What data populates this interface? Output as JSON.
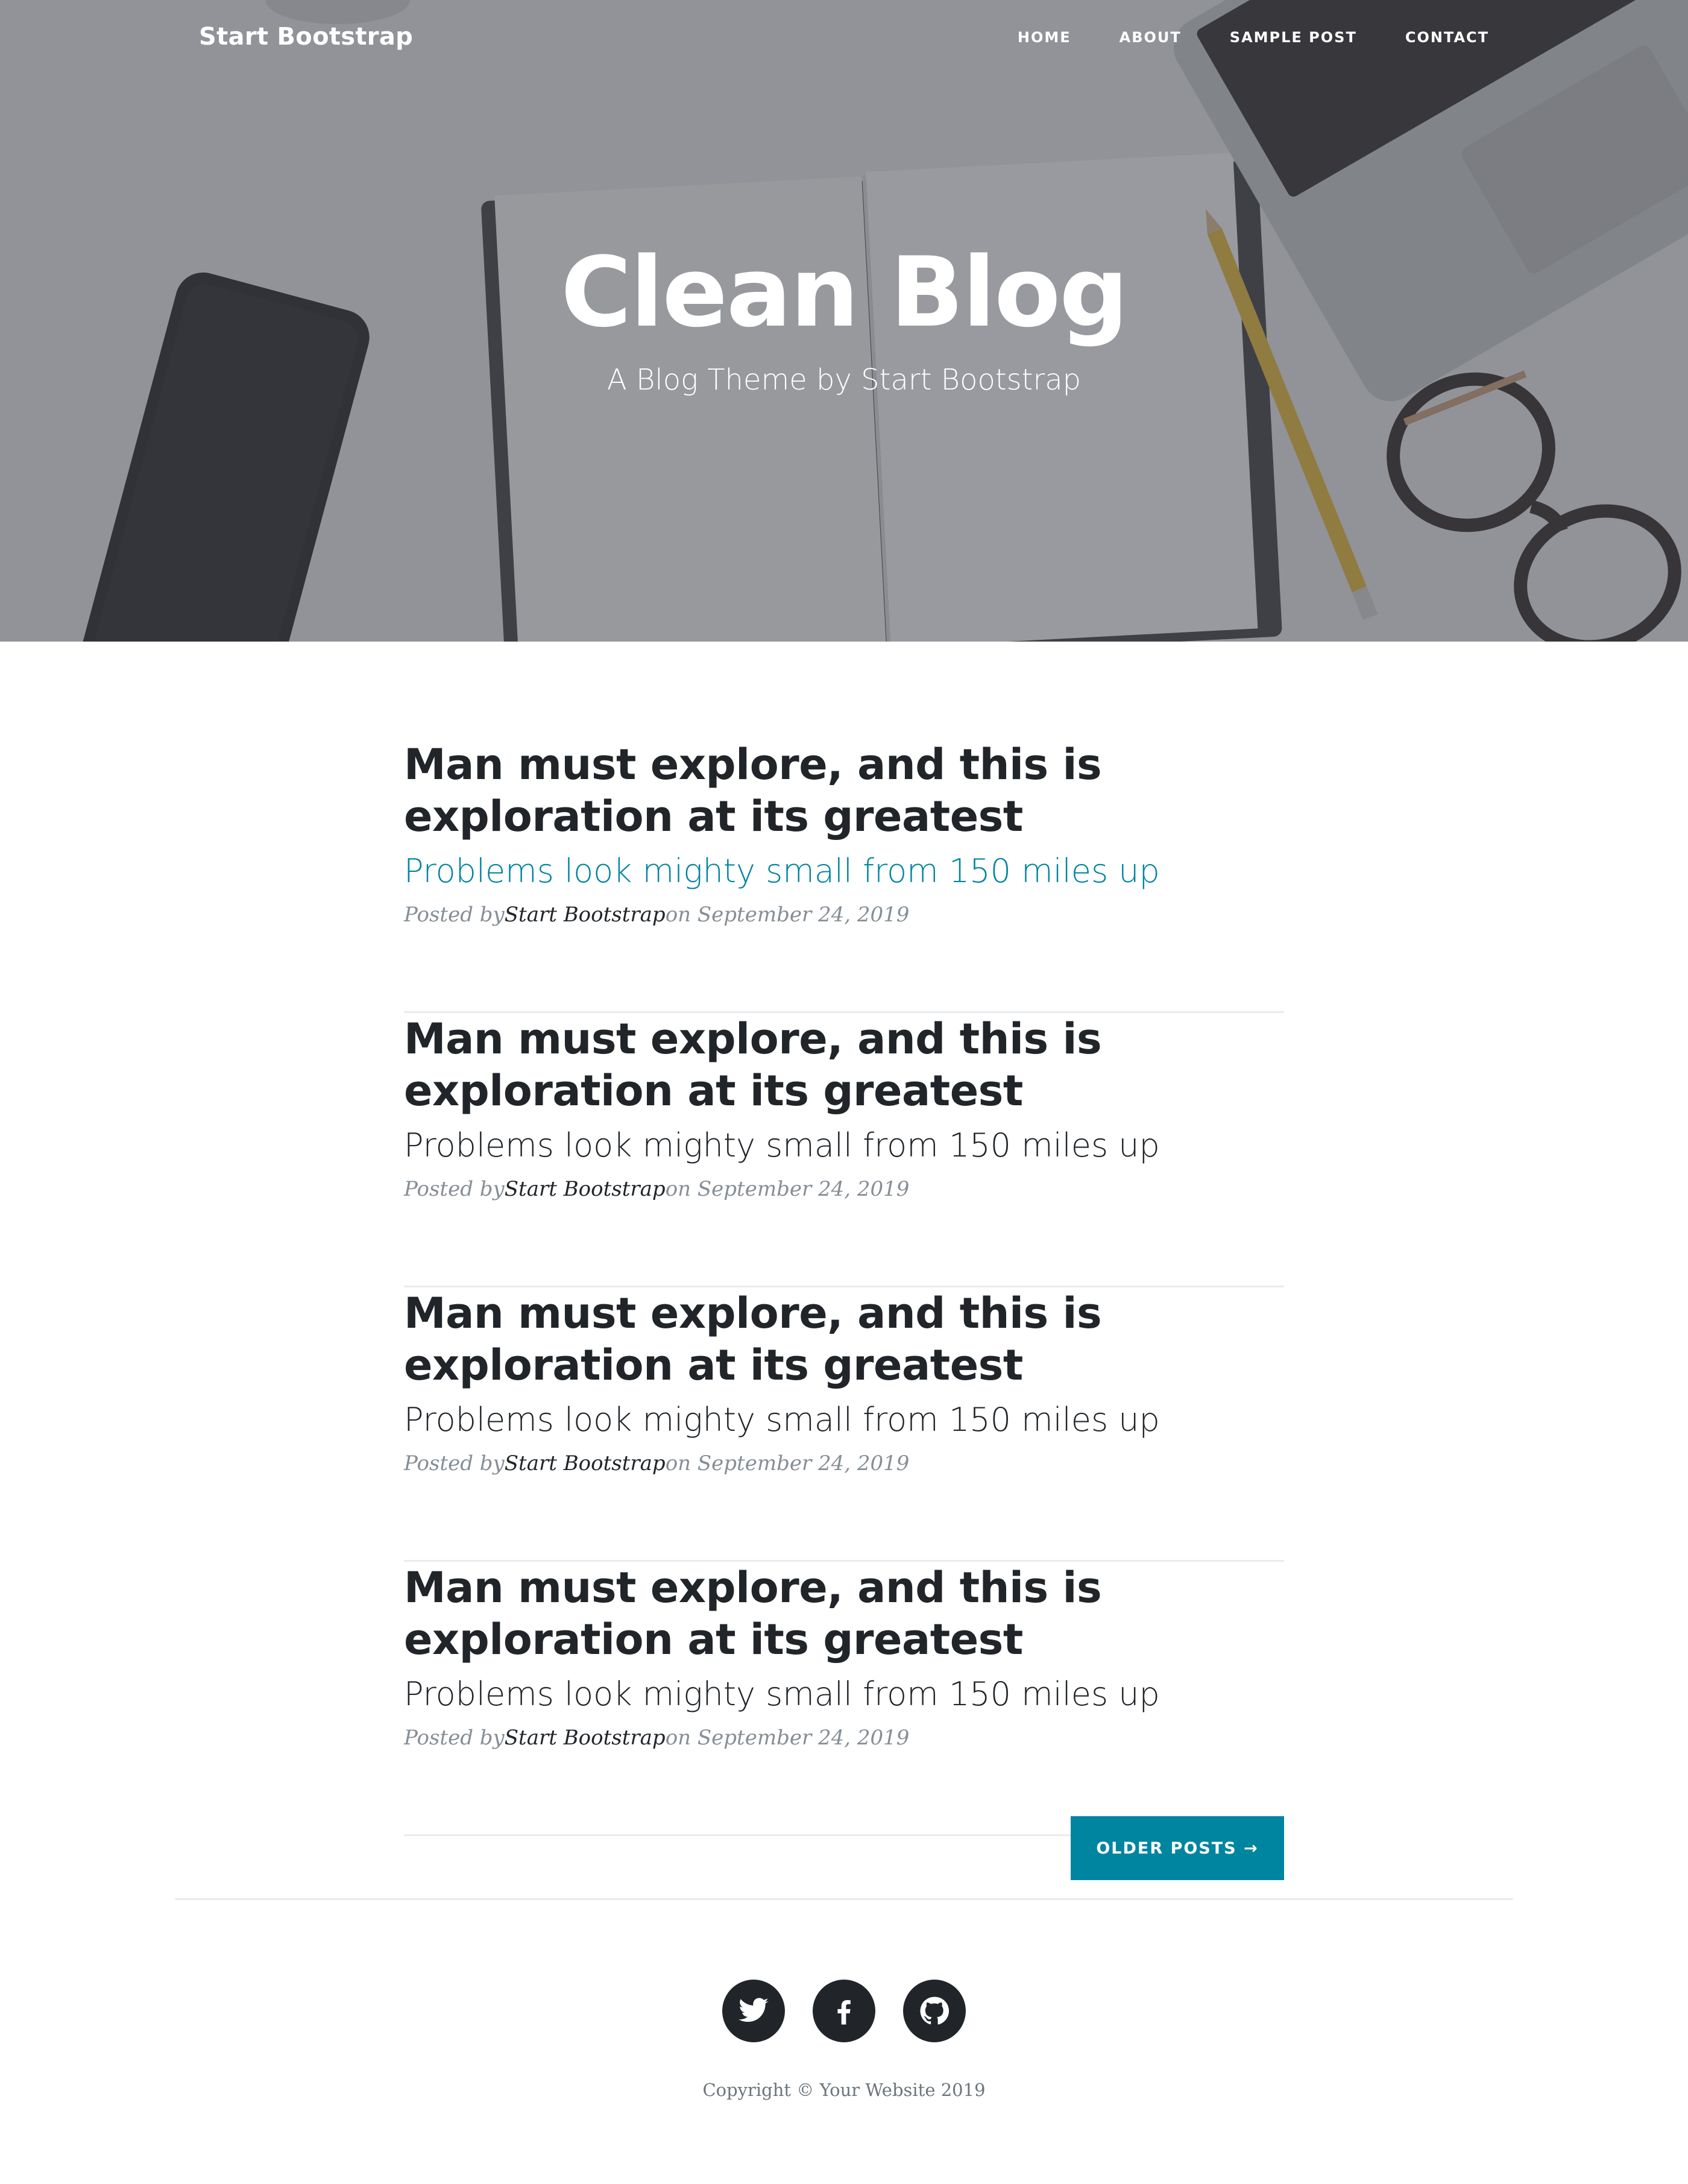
{
  "navbar": {
    "brand": "Start Bootstrap",
    "links": [
      {
        "label": "HOME"
      },
      {
        "label": "ABOUT"
      },
      {
        "label": "SAMPLE POST"
      },
      {
        "label": "CONTACT"
      }
    ]
  },
  "hero": {
    "title": "Clean Blog",
    "subtitle": "A Blog Theme by Start Bootstrap"
  },
  "posts": [
    {
      "title": "Man must explore, and this is exploration at its greatest",
      "subtitle": "Problems look mighty small from 150 miles up",
      "meta_prefix": "Posted by",
      "author": "Start Bootstrap",
      "meta_suffix": "on September 24, 2019"
    },
    {
      "title": "Man must explore, and this is exploration at its greatest",
      "subtitle": "Problems look mighty small from 150 miles up",
      "meta_prefix": "Posted by",
      "author": "Start Bootstrap",
      "meta_suffix": "on September 24, 2019"
    },
    {
      "title": "Man must explore, and this is exploration at its greatest",
      "subtitle": "Problems look mighty small from 150 miles up",
      "meta_prefix": "Posted by",
      "author": "Start Bootstrap",
      "meta_suffix": "on September 24, 2019"
    },
    {
      "title": "Man must explore, and this is exploration at its greatest",
      "subtitle": "Problems look mighty small from 150 miles up",
      "meta_prefix": "Posted by",
      "author": "Start Bootstrap",
      "meta_suffix": "on September 24, 2019"
    }
  ],
  "pager": {
    "older_label": "OLDER POSTS →"
  },
  "footer": {
    "social": [
      {
        "icon": "twitter-icon"
      },
      {
        "icon": "facebook-icon"
      },
      {
        "icon": "github-icon"
      }
    ],
    "copyright": "Copyright © Your Website 2019"
  },
  "colors": {
    "accent": "#0085a1",
    "text": "#212529",
    "muted": "#868e96"
  }
}
